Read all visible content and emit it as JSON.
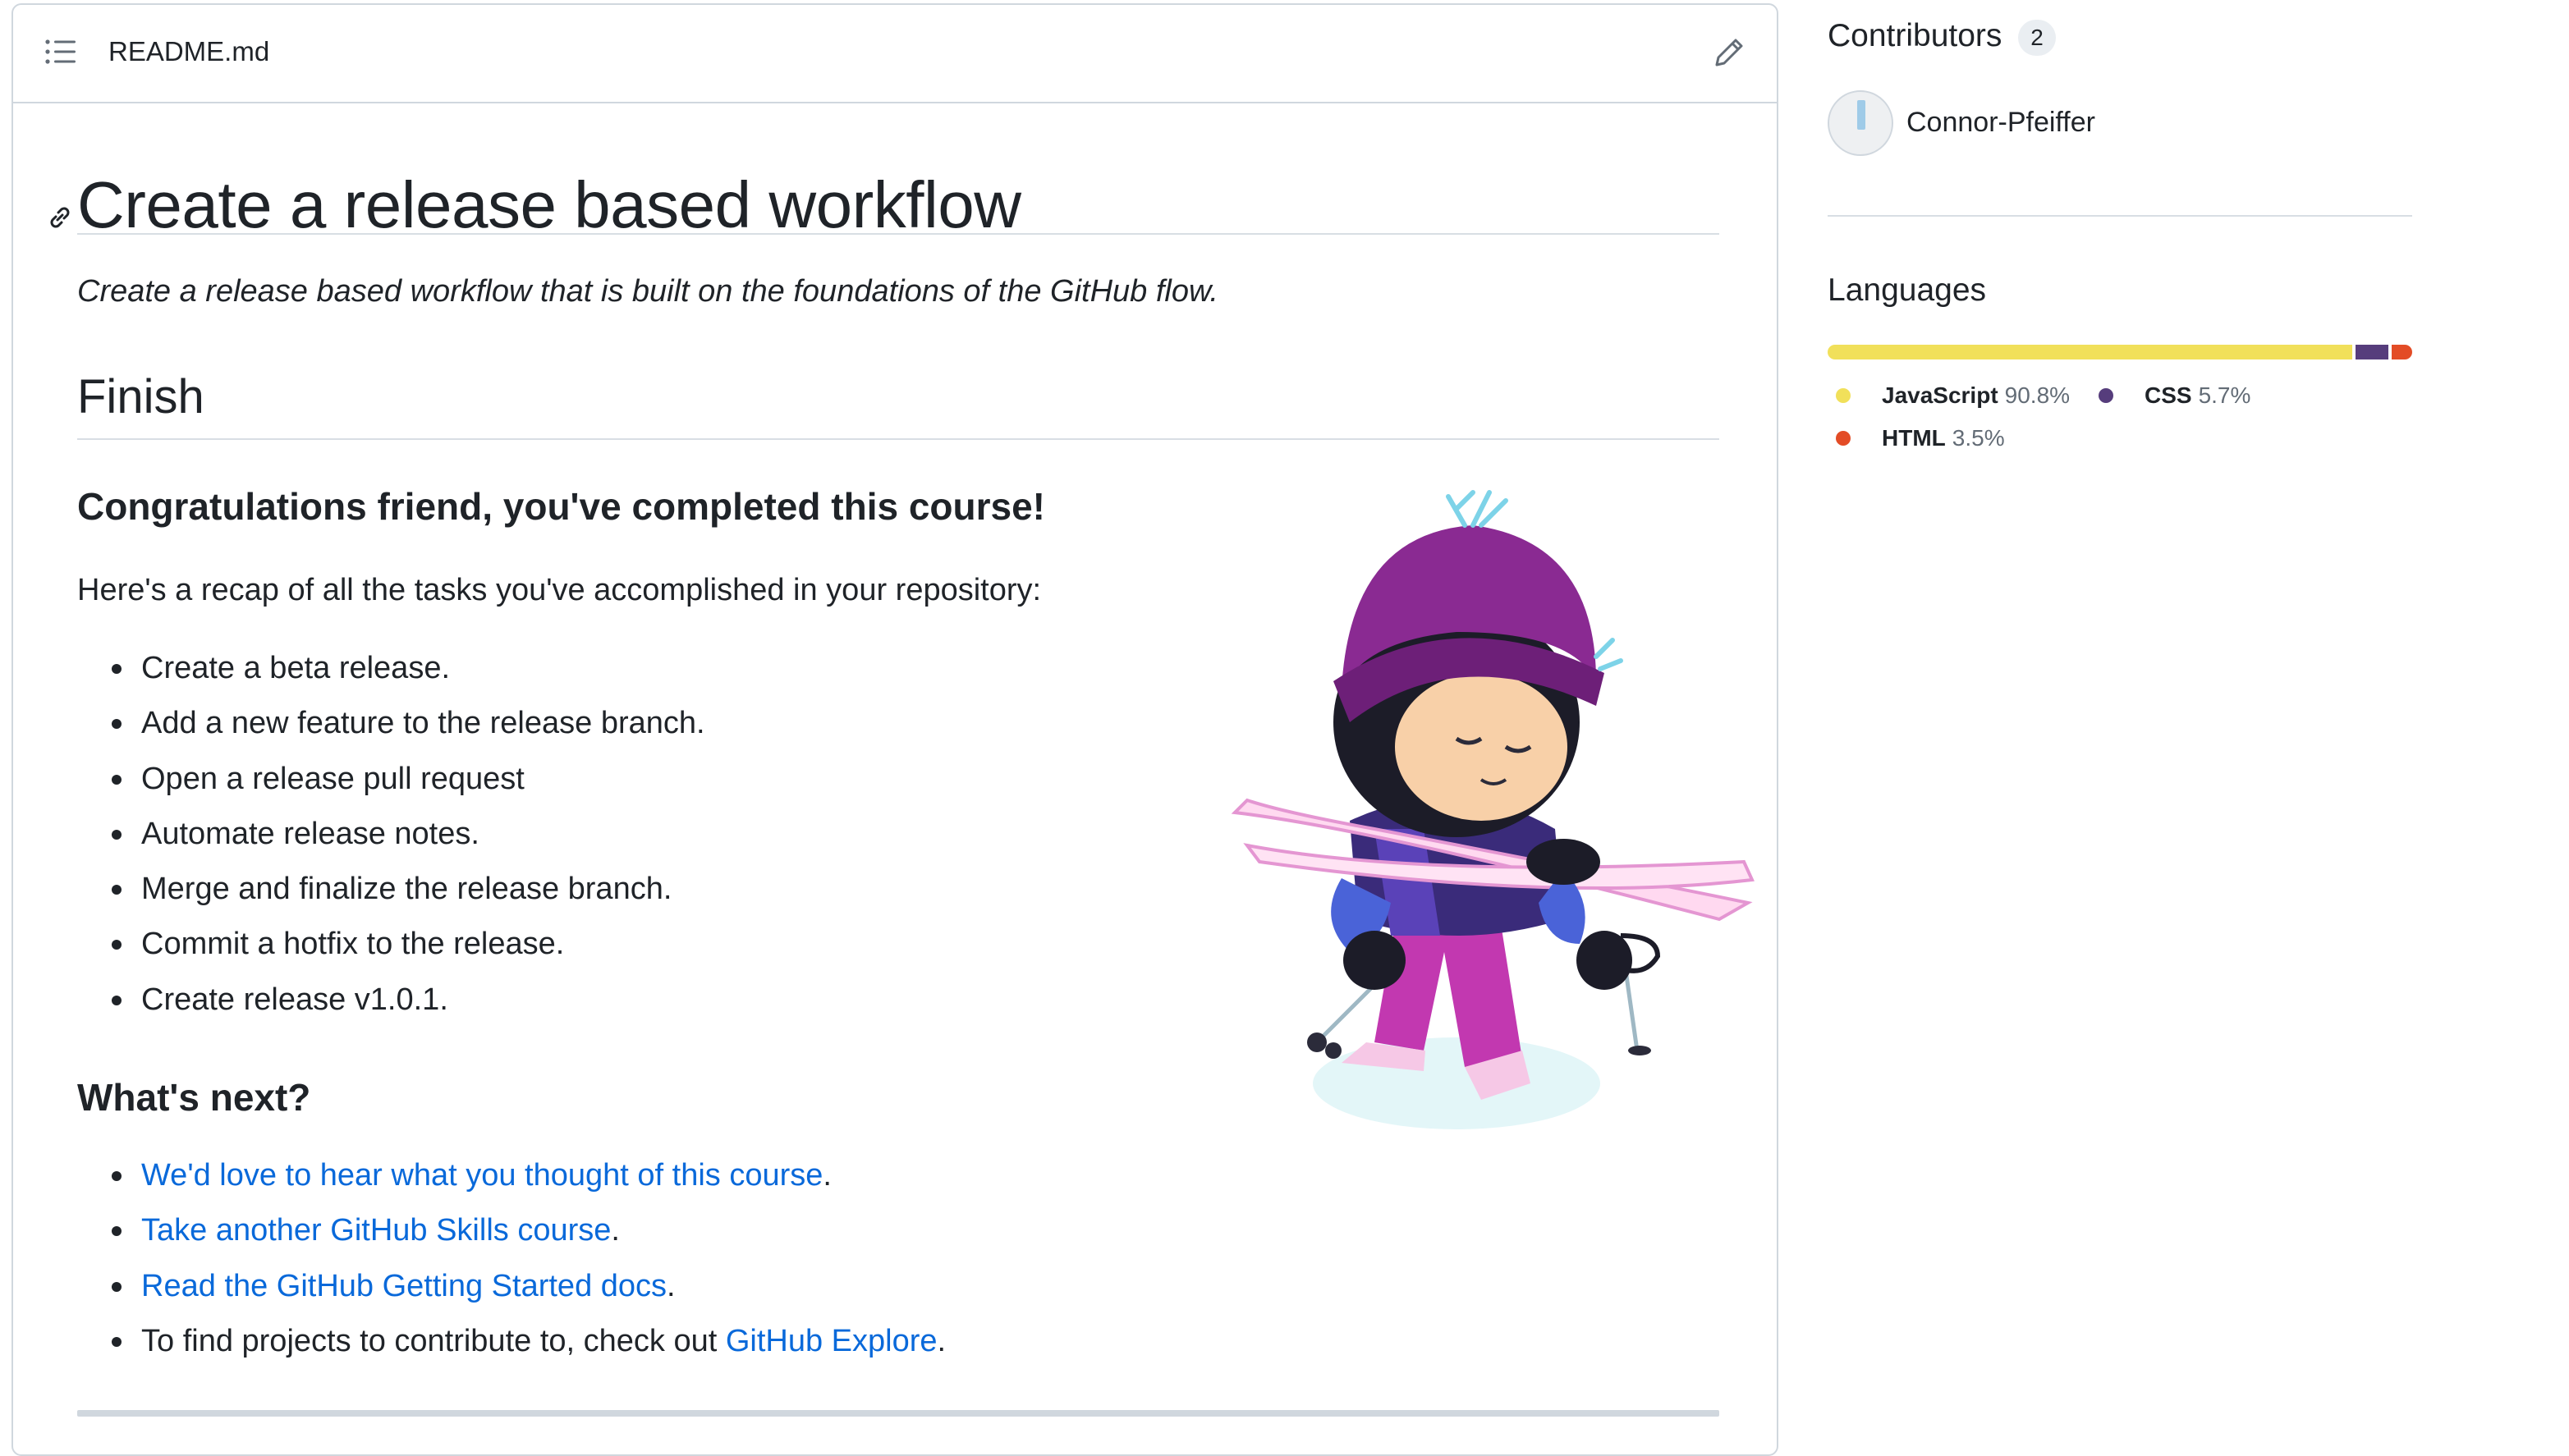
{
  "readme": {
    "filename": "README.md",
    "h1": "Create a release based workflow",
    "subtitle": "Create a release based workflow that is built on the foundations of the GitHub flow.",
    "h2": "Finish",
    "congrats": "Congratulations friend, you've completed this course!",
    "recap": "Here's a recap of all the tasks you've accomplished in your repository:",
    "tasks": [
      "Create a beta release.",
      "Add a new feature to the release branch.",
      "Open a release pull request",
      "Automate release notes.",
      "Merge and finalize the release branch.",
      "Commit a hotfix to the release.",
      "Create release v1.0.1."
    ],
    "whats_next": "What's next?",
    "next": [
      {
        "link": "We'd love to hear what you thought of this course",
        "after": "."
      },
      {
        "link": "Take another GitHub Skills course",
        "after": "."
      },
      {
        "link": "Read the GitHub Getting Started docs",
        "after": "."
      },
      {
        "before": "To find projects to contribute to, check out ",
        "link": "GitHub Explore",
        "after": "."
      }
    ]
  },
  "sidebar": {
    "contributors_title": "Contributors",
    "contributors_count": "2",
    "contributor_name": "Connor-Pfeiffer",
    "languages_title": "Languages",
    "languages": [
      {
        "name": "JavaScript",
        "percent": "90.8%",
        "value": 90.8,
        "color": "#f1e05a"
      },
      {
        "name": "CSS",
        "percent": "5.7%",
        "value": 5.7,
        "color": "#563d7c"
      },
      {
        "name": "HTML",
        "percent": "3.5%",
        "value": 3.5,
        "color": "#e34c26"
      }
    ]
  },
  "colors": {
    "link": "#0969da",
    "border": "#d0d7de"
  },
  "icons": [
    "list-icon",
    "pencil-icon",
    "link-anchor-icon"
  ]
}
